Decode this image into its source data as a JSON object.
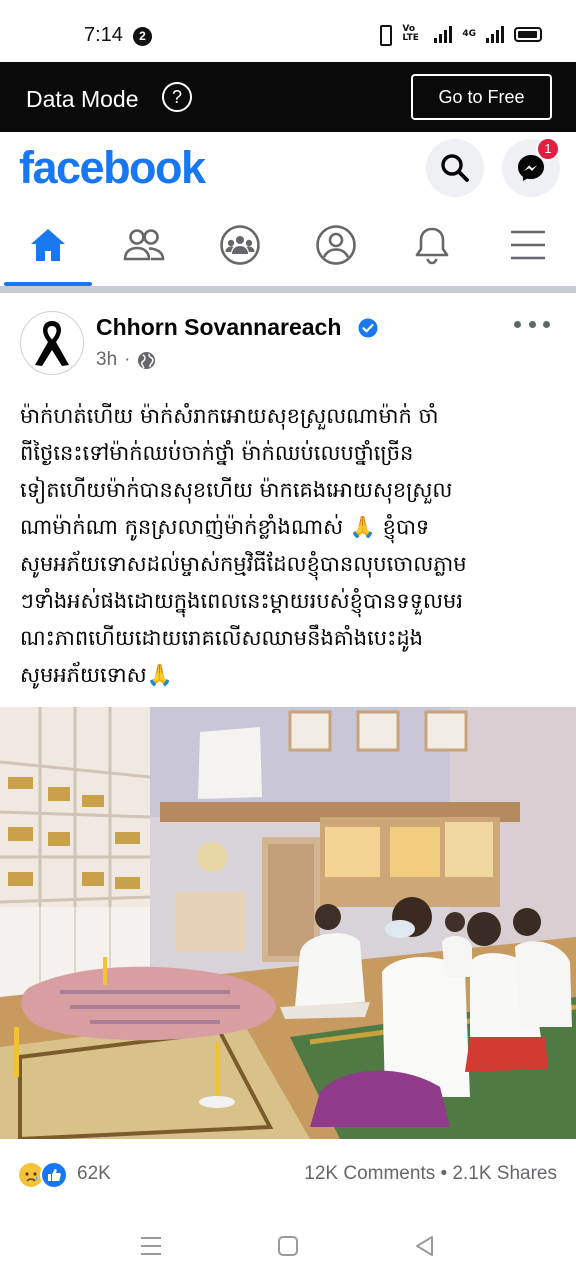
{
  "status_bar": {
    "time": "7:14",
    "notification_count": "2",
    "volte_label": "Vo LTE",
    "network_label": "4G"
  },
  "data_mode": {
    "label": "Data Mode",
    "help_symbol": "?",
    "go_free_label": "Go to Free"
  },
  "header": {
    "logo": "facebook",
    "messenger_badge": "1"
  },
  "nav_tabs": [
    {
      "name": "home",
      "icon": "home-icon",
      "active": true
    },
    {
      "name": "friends",
      "icon": "friends-icon",
      "active": false
    },
    {
      "name": "groups",
      "icon": "groups-icon",
      "active": false
    },
    {
      "name": "profile",
      "icon": "profile-icon",
      "active": false
    },
    {
      "name": "notifications",
      "icon": "bell-icon",
      "active": false
    },
    {
      "name": "menu",
      "icon": "menu-icon",
      "active": false
    }
  ],
  "post": {
    "author": "Chhorn Sovannareach",
    "verified": true,
    "time": "3h",
    "audience_icon": "globe-icon",
    "text": "ម៉ាក់ហត់ហើយ ម៉ាក់សំរាកអោយសុខស្រួលណាម៉ាក់ ចាំ\nពីថ្ងៃនេះទៅម៉ាក់ឈប់ចាក់ថ្នាំ ម៉ាក់ឈប់លេបថ្នាំច្រើន\nទៀតហើយម៉ាក់បានសុខហើយ ម៉ាកគេងអោយសុខស្រួល\nណាម៉ាក់ណា កូនស្រលាញ់ម៉ាក់ខ្លាំងណាស់ 🙏 ខ្ញុំបាទ\nសូមអភ័យទោសដល់ម្ចាស់កម្មវិធីដែលខ្ញុំបានលុបចោលភ្លាម\nៗទាំងអស់ផងដោយក្នុងពេលនេះម្តាយរបស់ខ្ញុំបានទទួលមរ\nណះភាពហើយដោយរោគលើសឈាមនឹងគាំងបេះដូង\nសូមអភ័យទោស🙏",
    "reaction_count": "62K",
    "comments_shares": "12K Comments • 2.1K Shares"
  },
  "colors": {
    "brand_blue": "#1877f2",
    "secondary_text": "#65676b",
    "badge_red": "#e41e3f"
  }
}
